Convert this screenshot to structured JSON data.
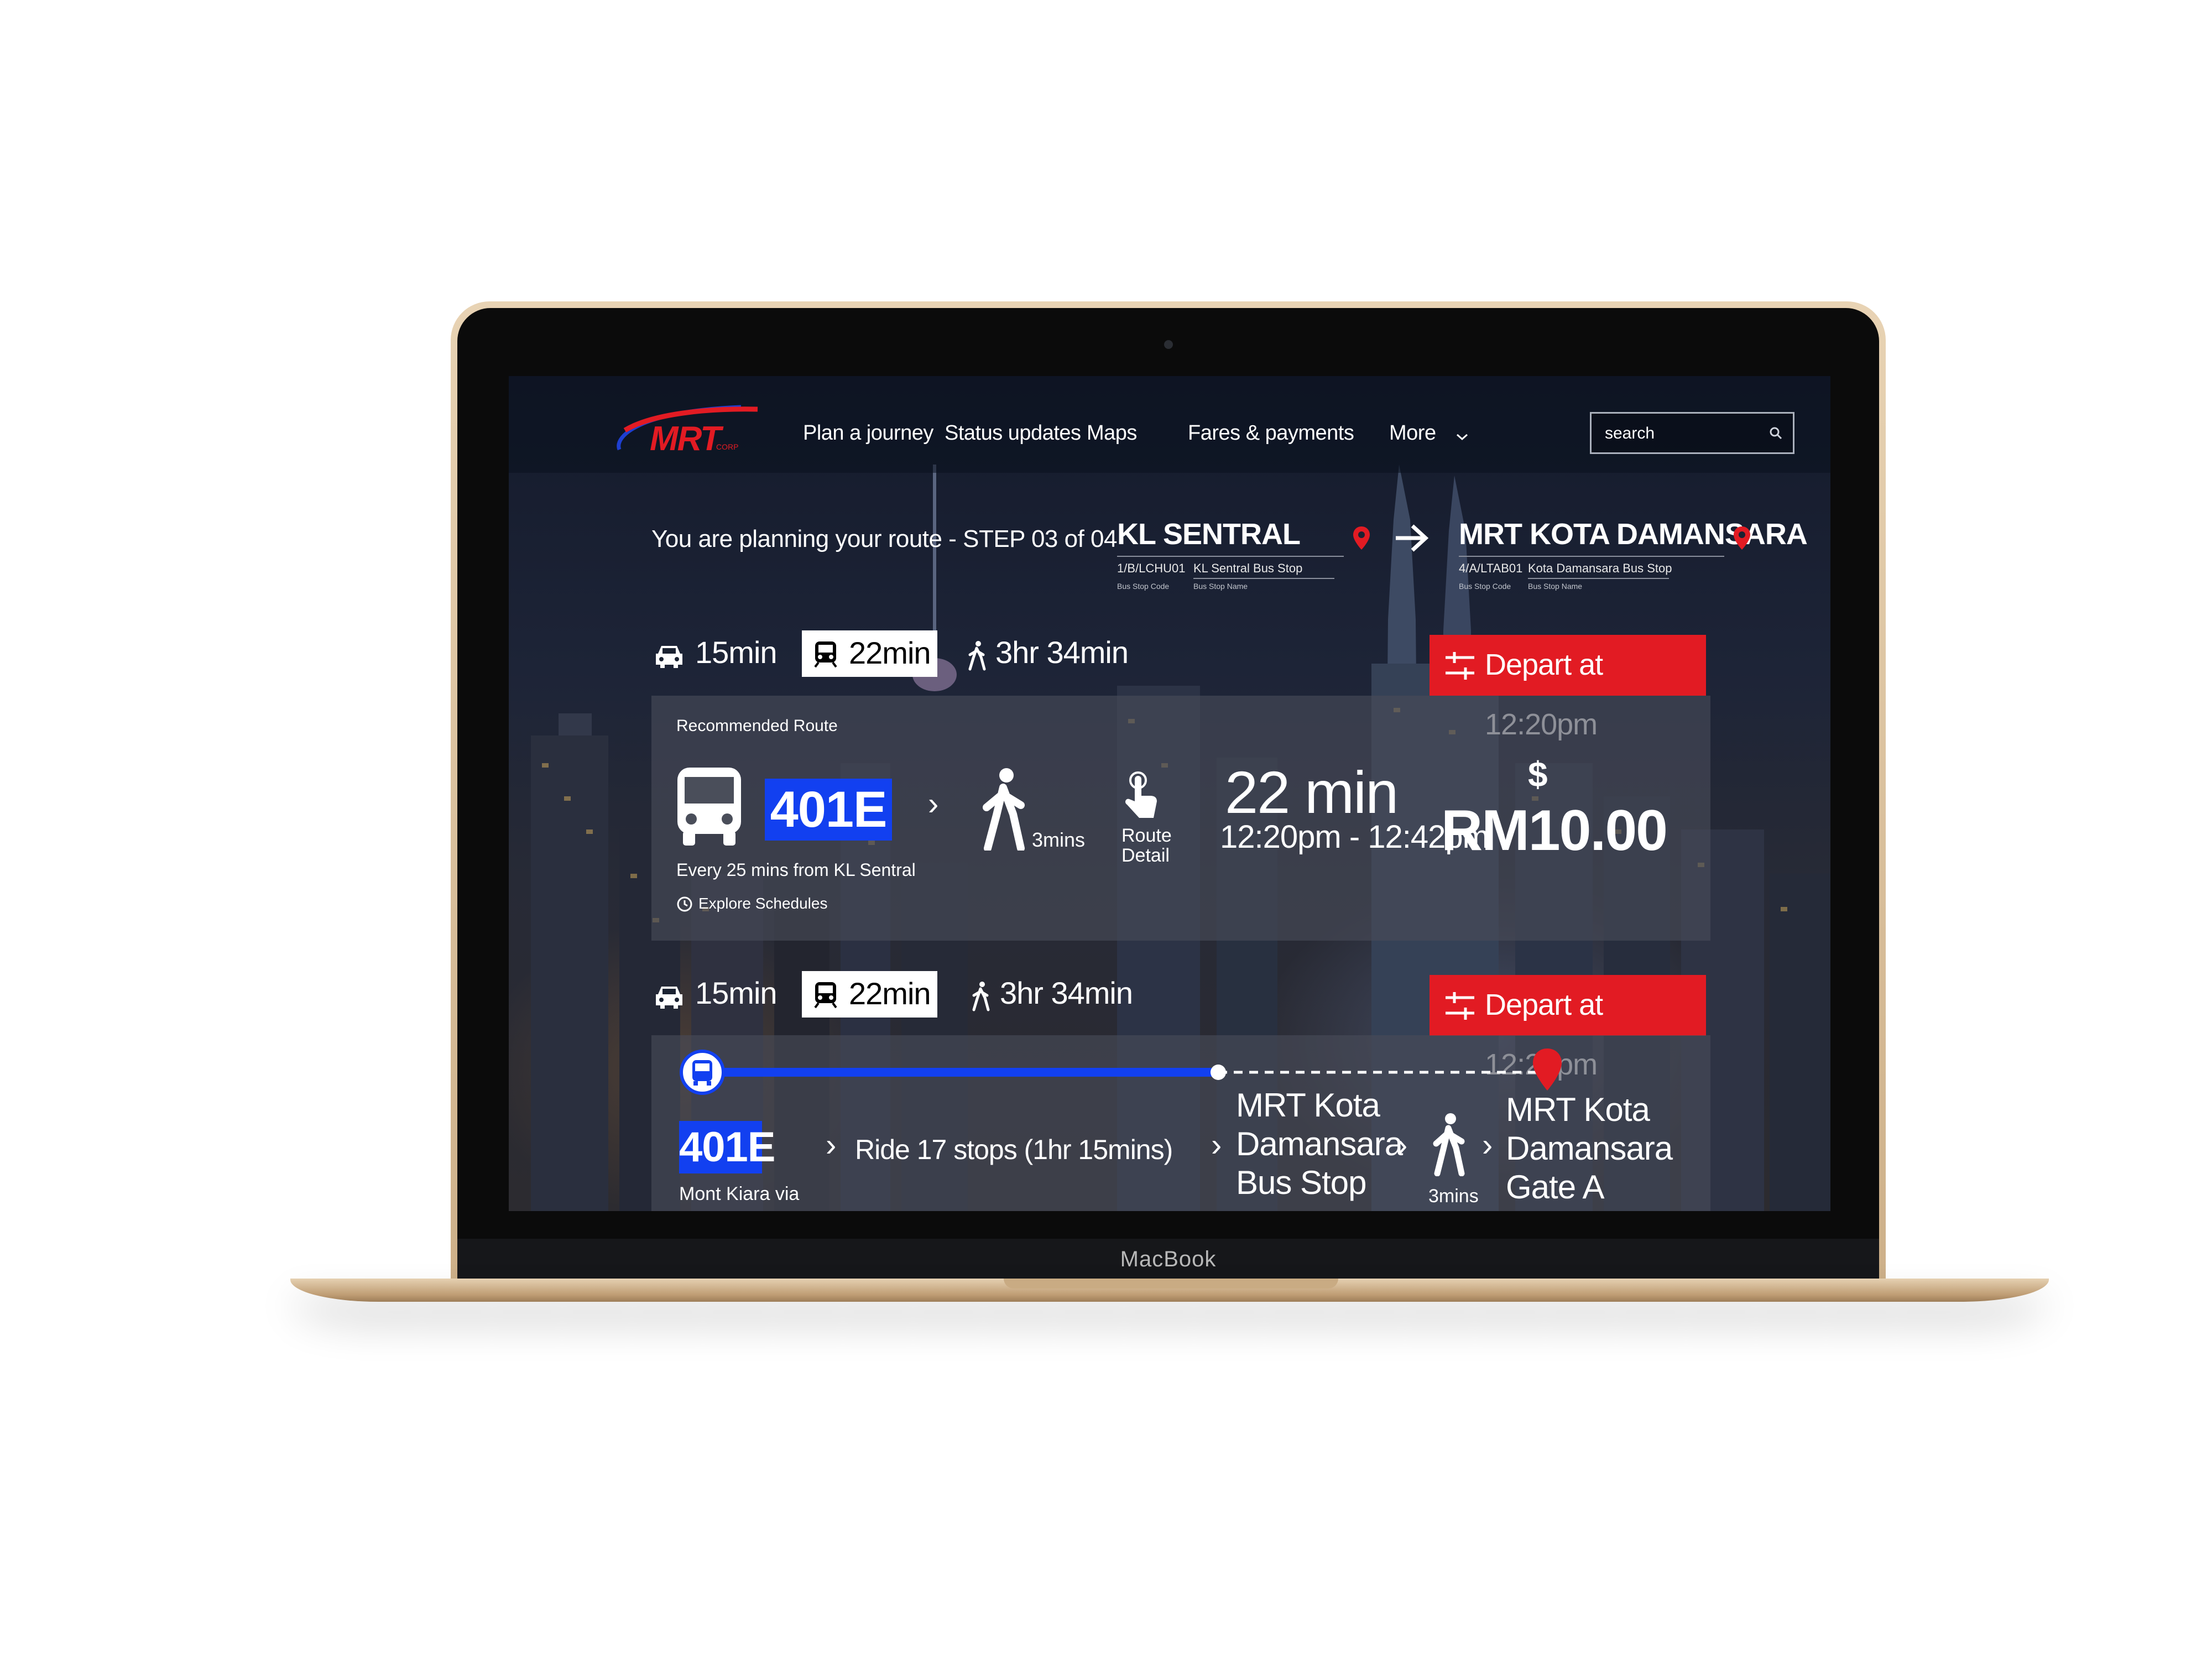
{
  "device": {
    "label": "MacBook"
  },
  "nav": {
    "logo_text": "MRT",
    "logo_sub": "CORP",
    "items": [
      {
        "label": "Plan a journey"
      },
      {
        "label": "Status updates"
      },
      {
        "label": "Maps"
      },
      {
        "label": "Fares & payments"
      },
      {
        "label": "More"
      }
    ],
    "search_placeholder": "search"
  },
  "route_header": {
    "step_title": "You are planning your route - STEP 03 of 04",
    "origin": {
      "name": "KL SENTRAL",
      "code": "1/B/LCHU01",
      "code_caption": "Bus Stop Code",
      "stop_name": "KL Sentral Bus Stop",
      "stop_name_caption": "Bus Stop Name"
    },
    "destination": {
      "name": "MRT KOTA DAMANSARA",
      "code": "4/A/LTAB01",
      "code_caption": "Bus Stop Code",
      "stop_name": "Kota Damansara Bus Stop",
      "stop_name_caption": "Bus Stop Name"
    }
  },
  "option1": {
    "car_time": "15min",
    "train_time": "22min",
    "walk_time": "3hr 34min",
    "depart": "Depart at 12:20pm",
    "card": {
      "label": "Recommended Route",
      "bus_number": "401E",
      "walk_label": "3mins",
      "route_detail_line1": "Route",
      "route_detail_line2": "Detail",
      "frequency": "Every 25 mins from KL Sentral",
      "explore": "Explore Schedules",
      "duration": "22 min",
      "time_range": "12:20pm - 12:42pm",
      "currency_symbol": "$",
      "price": "RM10.00"
    }
  },
  "option2": {
    "car_time": "15min",
    "train_time": "22min",
    "walk_time": "3hr 34min",
    "depart": "Depart at 12:20pm",
    "card": {
      "bus_number": "401E",
      "bus_sub": "Mont Kiara via",
      "ride": "Ride 17 stops (1hr 15mins)",
      "stop_a_line1": "MRT Kota",
      "stop_a_line2": "Damansara",
      "stop_a_line3": "Bus Stop",
      "walk_label": "3mins",
      "stop_b_line1": "MRT Kota",
      "stop_b_line2": "Damansara",
      "stop_b_line3": "Gate A"
    }
  },
  "colors": {
    "accent_red": "#e21b23",
    "bus_blue": "#1240f0"
  }
}
